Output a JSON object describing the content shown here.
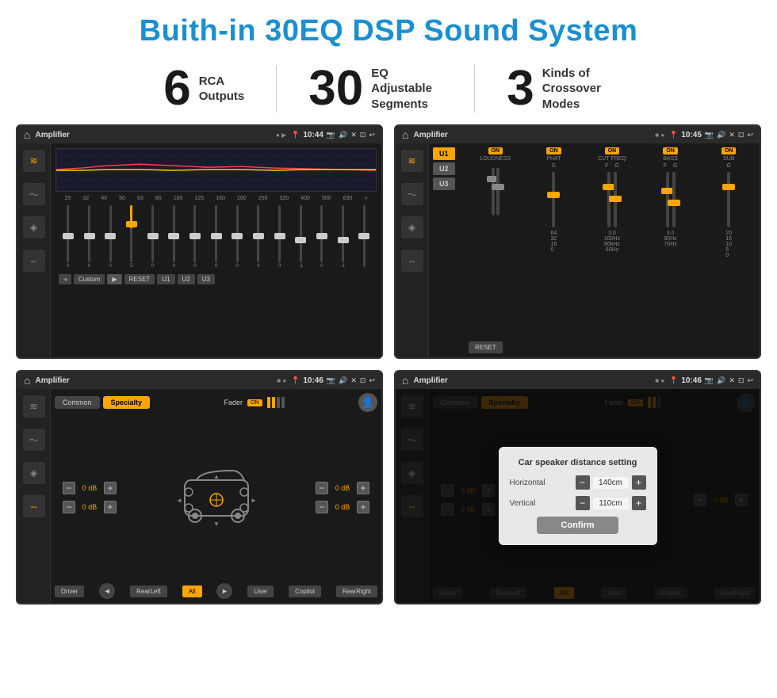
{
  "page": {
    "title": "Buith-in 30EQ DSP Sound System",
    "stats": [
      {
        "number": "6",
        "text": "RCA\nOutputs"
      },
      {
        "number": "30",
        "text": "EQ Adjustable\nSegments"
      },
      {
        "number": "3",
        "text": "Kinds of\nCrossover Modes"
      }
    ]
  },
  "screens": {
    "screen1": {
      "title": "Amplifier",
      "time": "10:44",
      "eq_freq": [
        "25",
        "32",
        "40",
        "50",
        "63",
        "80",
        "100",
        "125",
        "160",
        "200",
        "250",
        "320",
        "400",
        "500",
        "630"
      ],
      "eq_values": [
        "0",
        "0",
        "0",
        "5",
        "0",
        "0",
        "0",
        "0",
        "0",
        "0",
        "0",
        "-1",
        "0",
        "-1",
        ""
      ],
      "preset_label": "Custom",
      "buttons": [
        "RESET",
        "U1",
        "U2",
        "U3"
      ]
    },
    "screen2": {
      "title": "Amplifier",
      "time": "10:45",
      "presets": [
        "U1",
        "U2",
        "U3"
      ],
      "controls": [
        "LOUDNESS",
        "PHAT",
        "CUT FREQ",
        "BASS",
        "SUB"
      ],
      "reset_label": "RESET"
    },
    "screen3": {
      "title": "Amplifier",
      "time": "10:46",
      "tabs": [
        "Common",
        "Specialty"
      ],
      "fader_label": "Fader",
      "db_values": [
        "0 dB",
        "0 dB",
        "0 dB",
        "0 dB"
      ],
      "buttons": [
        "Driver",
        "Copilot",
        "RearLeft",
        "All",
        "User",
        "RearRight"
      ]
    },
    "screen4": {
      "title": "Amplifier",
      "time": "10:46",
      "tabs": [
        "Common",
        "Specialty"
      ],
      "dialog": {
        "title": "Car speaker distance setting",
        "horizontal_label": "Horizontal",
        "horizontal_value": "140cm",
        "vertical_label": "Vertical",
        "vertical_value": "110cm",
        "confirm_label": "Confirm"
      },
      "db_values": [
        "0 dB",
        "0 dB"
      ],
      "buttons": [
        "Driver",
        "Copilot",
        "RearLeft",
        "All",
        "User",
        "RearRight"
      ]
    }
  },
  "icons": {
    "home": "⌂",
    "back": "↩",
    "location": "📍",
    "camera": "📷",
    "volume": "🔊",
    "close": "✕",
    "window": "⊡",
    "eq": "≋",
    "wave": "〜",
    "speaker": "◈",
    "arrows": "⇔",
    "person": "👤"
  }
}
